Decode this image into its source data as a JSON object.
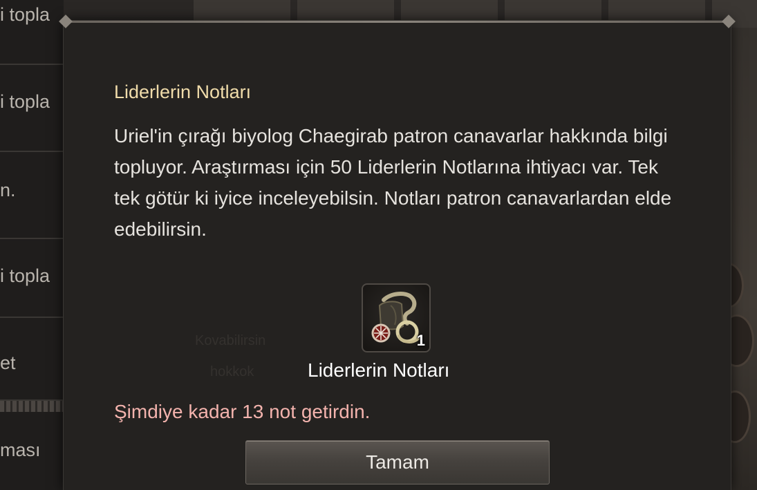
{
  "quest_list": {
    "items": [
      {
        "label": "i topla"
      },
      {
        "label": "i topla"
      },
      {
        "label": "n."
      },
      {
        "label": "i topla"
      },
      {
        "label": "et"
      },
      {
        "label": "ması"
      }
    ]
  },
  "dialog": {
    "title": "Liderlerin Notları",
    "body": "Uriel'in çırağı biyolog Chaegirab patron canavarlar hakkında bilgi topluyor. Araştırması için 50 Liderlerin Notlarına ihtiyacı var. Tek tek götür ki iyice inceleyebilsin. Notları patron canavarlardan elde edebilirsin.",
    "reward": {
      "icon": "leader-notes-icon",
      "count": "1",
      "name": "Liderlerin Notları"
    },
    "progress_text": "Şimdiye kadar 13 not getirdin.",
    "ok_button_label": "Tamam"
  },
  "colors": {
    "title": "#f0dcaa",
    "body": "#e6e3de",
    "progress": "#f3b3ad",
    "dialog_bg": "#242220"
  }
}
